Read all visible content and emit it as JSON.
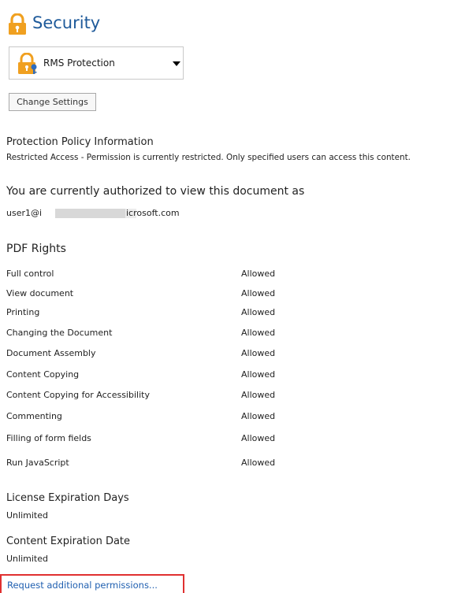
{
  "header": {
    "title": "Security",
    "icon": "padlock-icon"
  },
  "protection": {
    "selected": "RMS Protection",
    "icon": "padlock-key-icon"
  },
  "change_settings_label": "Change Settings",
  "policy": {
    "heading": "Protection Policy Information",
    "description": "Restricted Access - Permission is currently restricted. Only specified users can access this content."
  },
  "authorization": {
    "heading": "You are currently authorized to view this document as",
    "user_prefix": "user1@i",
    "user_suffix": "icrosoft.com"
  },
  "pdf_rights": {
    "heading": "PDF Rights",
    "rows": [
      {
        "name": "Full control",
        "value": "Allowed"
      },
      {
        "name": "View document",
        "value": "Allowed"
      },
      {
        "name": "Printing",
        "value": "Allowed"
      },
      {
        "name": "Changing the Document",
        "value": "Allowed"
      },
      {
        "name": "Document Assembly",
        "value": "Allowed"
      },
      {
        "name": "Content Copying",
        "value": "Allowed"
      },
      {
        "name": "Content Copying for Accessibility",
        "value": "Allowed"
      },
      {
        "name": "Commenting",
        "value": "Allowed"
      },
      {
        "name": "Filling of form fields",
        "value": "Allowed"
      },
      {
        "name": "Run JavaScript",
        "value": "Allowed"
      }
    ]
  },
  "license_expiration": {
    "heading": "License Expiration Days",
    "value": "Unlimited"
  },
  "content_expiration": {
    "heading": "Content Expiration Date",
    "value": "Unlimited"
  },
  "request_link_label": "Request additional permissions...",
  "colors": {
    "title_blue": "#1e5a9a",
    "link_blue": "#1f5fb0",
    "highlight_red": "#e03030",
    "lock_orange": "#f0a020"
  }
}
